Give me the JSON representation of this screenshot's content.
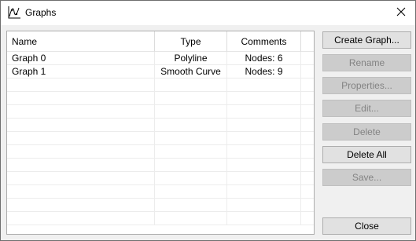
{
  "window": {
    "title": "Graphs"
  },
  "table": {
    "columns": [
      "Name",
      "Type",
      "Comments"
    ],
    "rows": [
      {
        "name": "Graph 0",
        "type": "Polyline",
        "comments": "Nodes: 6"
      },
      {
        "name": "Graph 1",
        "type": "Smooth Curve",
        "comments": "Nodes: 9"
      }
    ]
  },
  "buttons": {
    "create_graph": "Create Graph...",
    "rename": "Rename",
    "properties": "Properties...",
    "edit": "Edit...",
    "delete": "Delete",
    "delete_all": "Delete All",
    "save": "Save...",
    "close": "Close"
  },
  "colors": {
    "window_bg": "#f0f0f0",
    "button_bg": "#e1e1e1",
    "button_disabled_bg": "#cccccc",
    "disabled_text": "#838383"
  },
  "icons": {
    "title": "graph-curve-icon",
    "close": "close-icon"
  }
}
